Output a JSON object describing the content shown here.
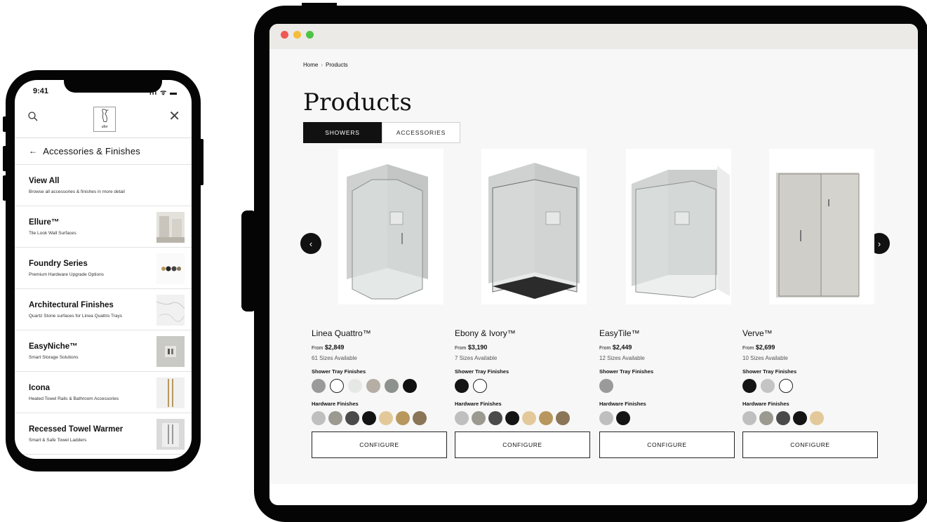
{
  "phone": {
    "status": {
      "time": "9:41",
      "icons": "ıll ᯤ ▬"
    },
    "logo_text": "ufor",
    "back_label": "Accessories & Finishes",
    "items": [
      {
        "title": "View All",
        "subtitle": "Browse all accessories & finishes in more detail"
      },
      {
        "title": "Ellure™",
        "subtitle": "Tile Look Wall Surfaces",
        "thumb": "#d9d6cf"
      },
      {
        "title": "Foundry Series",
        "subtitle": "Premium Hardware Upgrade Options",
        "thumb": "#f2f2f2"
      },
      {
        "title": "Architectural Finishes",
        "subtitle": "Quartz Stone surfaces for Linea Quattro Trays",
        "thumb": "#ececec"
      },
      {
        "title": "EasyNiche™",
        "subtitle": "Smart Storage Solutions",
        "thumb": "#cfcfcf"
      },
      {
        "title": "Icona",
        "subtitle": "Heated Towel Rails & Bathroom Accessories",
        "thumb": "#ececec"
      },
      {
        "title": "Recessed Towel Warmer",
        "subtitle": "Smart & Safe Towel Ladders",
        "thumb": "#dcdcdc"
      },
      {
        "title": "...",
        "subtitle": "",
        "thumb": "#e8dcc8"
      }
    ]
  },
  "tablet": {
    "breadcrumb": {
      "home": "Home",
      "sep": "›",
      "current": "Products"
    },
    "title": "Products",
    "tabs": [
      {
        "label": "SHOWERS",
        "active": true
      },
      {
        "label": "ACCESSORIES",
        "active": false
      }
    ],
    "prev_icon": "‹",
    "next_icon": "›",
    "products": [
      {
        "name": "Linea Quattro™",
        "from": "From",
        "price": "$2,849",
        "sizes": "61 Sizes Available",
        "tray_label": "Shower Tray Finishes",
        "tray": [
          "#9a9a9a",
          "#ffffff",
          "#e6e8e6",
          "#b4aea4",
          "#8e928e",
          "#111111"
        ],
        "hw_label": "Hardware Finishes",
        "hw": [
          "#bfbfbf",
          "#9a9a90",
          "#4a4a4a",
          "#141414",
          "#e3c99a",
          "#b8975e",
          "#8a7556"
        ],
        "cta": "CONFIGURE"
      },
      {
        "name": "Ebony & Ivory™",
        "from": "From",
        "price": "$3,190",
        "sizes": "7 Sizes Available",
        "tray_label": "Shower Tray Finishes",
        "tray": [
          "#141414",
          "#ffffff"
        ],
        "hw_label": "Hardware Finishes",
        "hw": [
          "#bfbfbf",
          "#9a9a90",
          "#4a4a4a",
          "#141414",
          "#e3c99a",
          "#b8975e",
          "#8a7556"
        ],
        "cta": "CONFIGURE"
      },
      {
        "name": "EasyTile™",
        "from": "From",
        "price": "$2,449",
        "sizes": "12 Sizes Available",
        "tray_label": "Shower Tray Finishes",
        "tray": [
          "#9a9a9a"
        ],
        "hw_label": "Hardware Finishes",
        "hw": [
          "#bfbfbf",
          "#141414"
        ],
        "cta": "CONFIGURE"
      },
      {
        "name": "Verve™",
        "from": "From",
        "price": "$2,699",
        "sizes": "10 Sizes Available",
        "tray_label": "Shower Tray Finishes",
        "tray": [
          "#141414",
          "#c4c4c4",
          "#ffffff"
        ],
        "hw_label": "Hardware Finishes",
        "hw": [
          "#bfbfbf",
          "#9a9a90",
          "#4a4a4a",
          "#141414",
          "#e3c99a"
        ],
        "cta": "CONFIGURE"
      }
    ]
  }
}
